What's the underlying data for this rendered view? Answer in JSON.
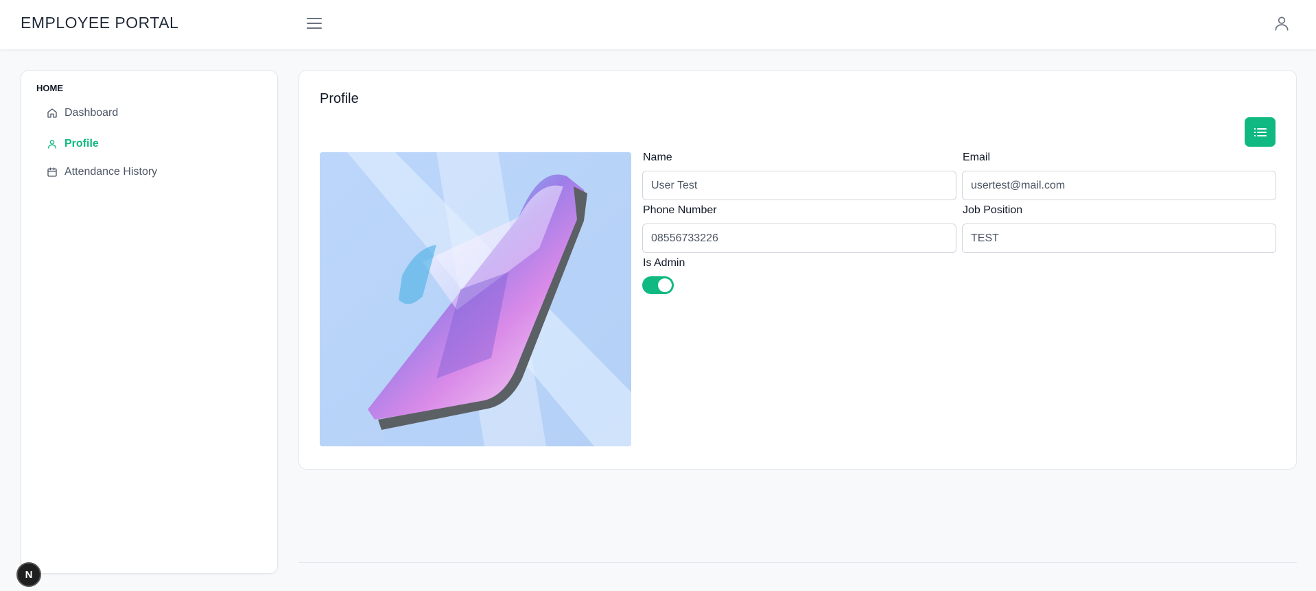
{
  "app": {
    "title": "EMPLOYEE PORTAL",
    "accent_color": "#10b981"
  },
  "header": {
    "menu_icon": "hamburger-icon",
    "user_icon": "user-icon"
  },
  "sidebar": {
    "section": "HOME",
    "items": [
      {
        "label": "Dashboard",
        "icon": "home-icon",
        "active": false
      },
      {
        "label": "Profile",
        "icon": "user-icon",
        "active": true
      },
      {
        "label": "Attendance History",
        "icon": "calendar-icon",
        "active": false
      }
    ]
  },
  "profile": {
    "title": "Profile",
    "list_button_icon": "list-icon",
    "fields": {
      "name": {
        "label": "Name",
        "value": "User Test"
      },
      "email": {
        "label": "Email",
        "value": "usertest@mail.com"
      },
      "phone": {
        "label": "Phone Number",
        "value": "08556733226"
      },
      "job": {
        "label": "Job Position",
        "value": "TEST"
      }
    },
    "is_admin": {
      "label": "Is Admin",
      "value": true
    }
  },
  "badge": {
    "text": "N"
  }
}
